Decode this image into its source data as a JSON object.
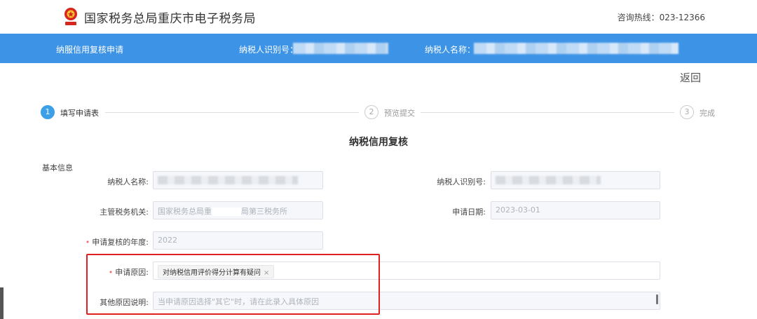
{
  "header": {
    "site_title": "国家税务总局重庆市电子税务局",
    "hotline": "咨询热线：023-12366",
    "logo_icon": "tax-emblem-icon"
  },
  "nav": {
    "page_name": "纳服信用复核申请",
    "taxpayer_id_label": "纳税人识别号：",
    "taxpayer_name_label": "纳税人名称："
  },
  "back_label": "返回",
  "steps": [
    {
      "num": "1",
      "label": "填写申请表",
      "state": "active"
    },
    {
      "num": "2",
      "label": "预览提交",
      "state": "todo"
    },
    {
      "num": "3",
      "label": "完成",
      "state": "todo"
    }
  ],
  "form": {
    "title": "纳税信用复核",
    "section": "基本信息",
    "taxpayer_name_label": "纳税人名称:",
    "taxpayer_id_label": "纳税人识别号:",
    "tax_authority_label": "主管税务机关:",
    "tax_authority_value_a": "国家税务总局重",
    "tax_authority_value_b": "局第三税务所",
    "apply_date_label": "申请日期:",
    "apply_date_value": "2023-03-01",
    "year_label": "申请复核的年度:",
    "year_value": "2022",
    "reason_label": "申请原因:",
    "reason_tag": "对纳税信用评价得分计算有疑问",
    "reason_tag_close": "×",
    "other_label": "其他原因说明:",
    "other_placeholder": "当申请原因选择\"其它\"时，请在此录入具体原因"
  },
  "colors": {
    "brand_blue": "#3d93e6",
    "step_active": "#3d9fe8",
    "required_star": "#f56c6c",
    "highlight_box": "#e02020"
  }
}
